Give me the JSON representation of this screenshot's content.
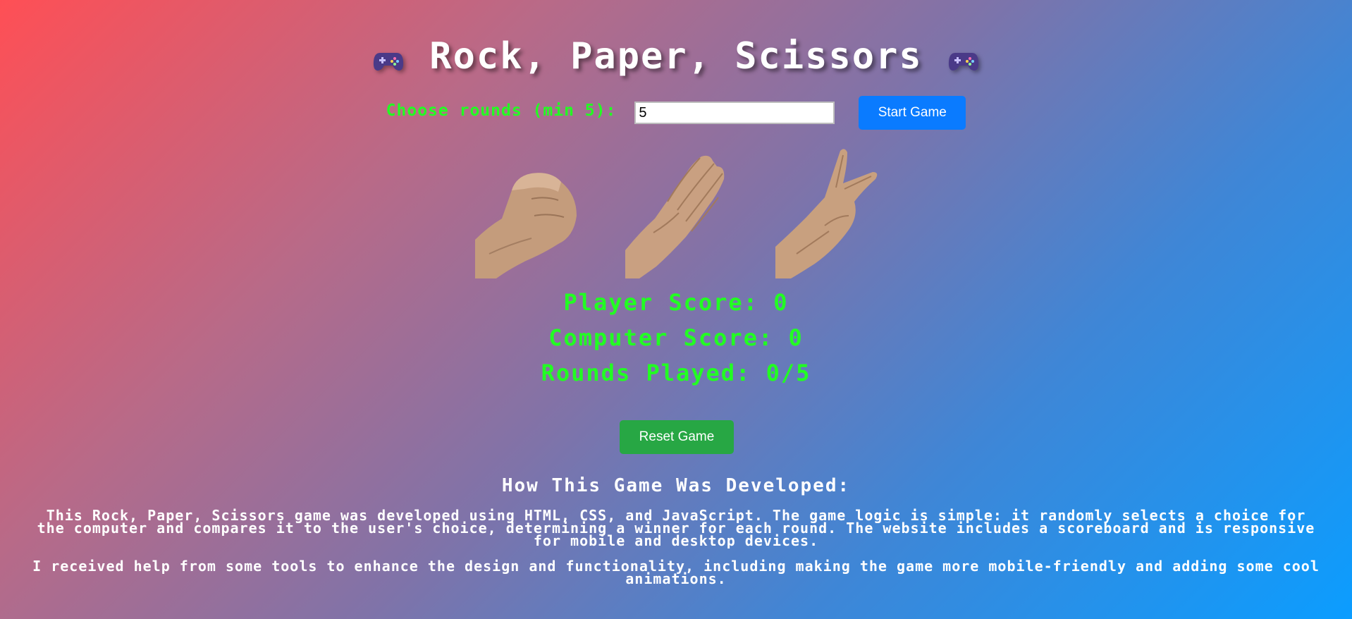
{
  "header": {
    "title": "Rock, Paper, Scissors",
    "left_icon": "gamepad-icon",
    "right_icon": "gamepad-icon"
  },
  "rounds": {
    "label": "Choose rounds (min 5):",
    "value": "5",
    "start_label": "Start Game"
  },
  "choices": [
    {
      "name": "rock",
      "icon": "rock-hand-image"
    },
    {
      "name": "paper",
      "icon": "paper-hand-image"
    },
    {
      "name": "scissors",
      "icon": "scissors-hand-image"
    }
  ],
  "scores": {
    "player": "Player Score: 0",
    "computer": "Computer Score: 0",
    "rounds_played": "Rounds Played: 0/5"
  },
  "reset_label": "Reset Game",
  "about": {
    "title": "How This Game Was Developed:",
    "paragraph1": "This Rock, Paper, Scissors game was developed using HTML, CSS, and JavaScript. The game logic is simple: it randomly selects a choice for the computer and compares it to the user's choice, determining a winner for each round. The website includes a scoreboard and is responsive for mobile and desktop devices.",
    "paragraph2": "I received help from some tools to enhance the design and functionality, including making the game more mobile-friendly and adding some cool animations."
  },
  "colors": {
    "accent_green": "#22ff22",
    "start_button": "#0a7bff",
    "reset_button": "#27a744",
    "gradient_start": "#ff4f55",
    "gradient_end": "#0b9dff"
  }
}
